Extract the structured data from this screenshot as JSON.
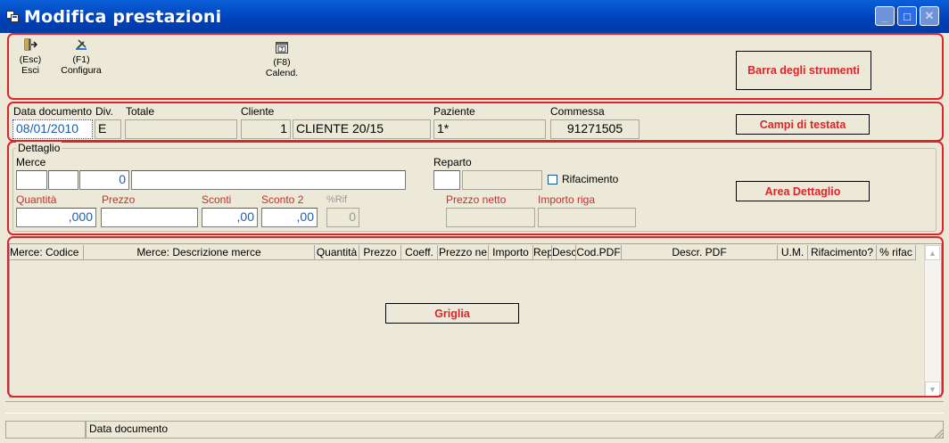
{
  "window": {
    "title": "Modifica prestazioni",
    "minimize_symbol": "_",
    "maximize_symbol": "□",
    "close_symbol": "✕"
  },
  "toolbar": {
    "buttons": [
      {
        "key": "(Esc)",
        "label": "Esci",
        "icon": "exit-door-icon"
      },
      {
        "key": "(F1)",
        "label": "Configura",
        "icon": "configure-tools-icon"
      },
      {
        "key": "(F8)",
        "label": "Calend.",
        "icon": "calendar-icon"
      }
    ]
  },
  "annotations": {
    "toolbar": "Barra degli strumenti",
    "header": "Campi di testata",
    "detail": "Area Dettaglio",
    "grid": "Griglia"
  },
  "header": {
    "data_documento_label": "Data documento",
    "data_documento_value": "08/01/2010",
    "div_label": "Div.",
    "div_value": "E",
    "totale_label": "Totale",
    "totale_value": "",
    "cliente_label": "Cliente",
    "cliente_code": "1",
    "cliente_name": "CLIENTE 20/15",
    "paziente_label": "Paziente",
    "paziente_value": "1*",
    "commessa_label": "Commessa",
    "commessa_value": "91271505"
  },
  "detail": {
    "group_label": "Dettaglio",
    "merce_label": "Merce",
    "merce_field1": "",
    "merce_field2": "",
    "merce_field3": "0",
    "merce_desc": "",
    "reparto_label": "Reparto",
    "rifacimento_label": "Rifacimento",
    "rifacimento_checked": false,
    "quantita_label": "Quantità",
    "quantita_value": ",000",
    "prezzo_label": "Prezzo",
    "prezzo_value": "",
    "sconti_label": "Sconti",
    "sconti_value": ",00",
    "sconto2_label": "Sconto 2",
    "sconto2_value": ",00",
    "rif_label": "%Rif",
    "rif_value": "0",
    "prezzo_netto_label": "Prezzo netto",
    "importo_riga_label": "Importo riga"
  },
  "grid": {
    "columns": [
      "Merce: Codice",
      "Merce: Descrizione merce",
      "Quantità",
      "Prezzo",
      "Coeff.",
      "Prezzo ne",
      "Importo",
      "Rep",
      "Desc",
      "Cod.PDF",
      "Descr. PDF",
      "U.M.",
      "Rifacimento?",
      "% rifac"
    ],
    "rows": []
  },
  "statusbar": {
    "panel1": "",
    "panel2": "Data documento"
  },
  "colors": {
    "titlebar": "#0a5fd8",
    "annotation_red": "#e0232a",
    "window_bg": "#ece9d8",
    "value_blue": "#1a5fb4"
  }
}
